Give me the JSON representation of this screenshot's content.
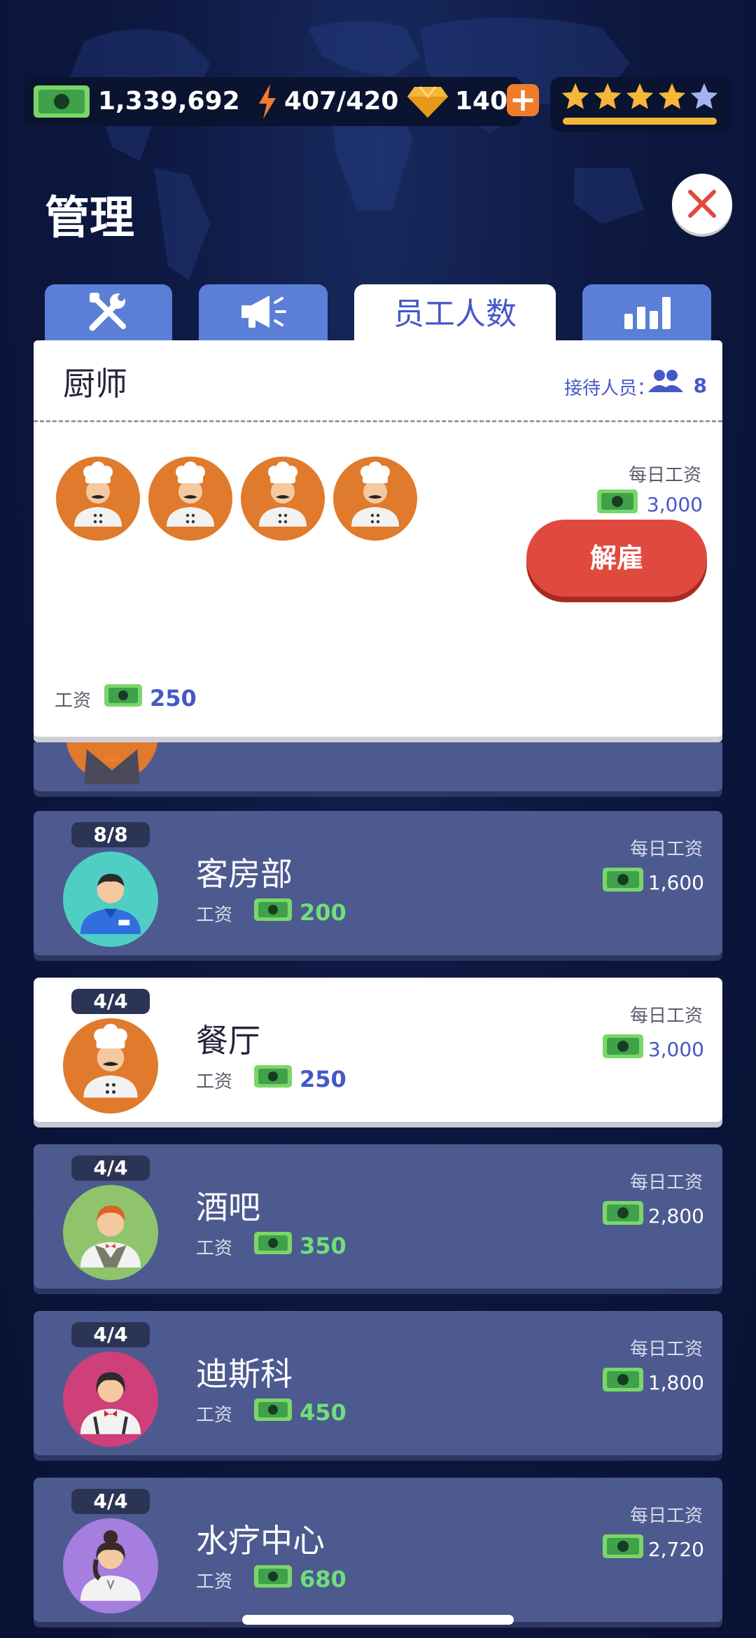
{
  "hud": {
    "money": "1,339,692",
    "energy": "407/420",
    "gems": "140",
    "plus": "+",
    "stars_filled": 4,
    "stars_total": 5
  },
  "page": {
    "title": "管理"
  },
  "tabs": [
    {
      "icon": "tools-icon",
      "label": ""
    },
    {
      "icon": "megaphone-icon",
      "label": ""
    },
    {
      "icon": "",
      "label": "员工人数"
    },
    {
      "icon": "bar-chart-icon",
      "label": ""
    }
  ],
  "detail": {
    "name": "厨师",
    "reception_label": "接待人员：",
    "reception_count": "8",
    "daily_wage_label": "每日工资",
    "daily_wage": "3,000",
    "fire_button": "解雇",
    "wage_label": "工资",
    "wage": "250",
    "staff_count": 4
  },
  "departments": [
    {
      "count": "8/8",
      "name": "客房部",
      "wage_label": "工资",
      "wage": "200",
      "daily_label": "每日工资",
      "daily": "1,600",
      "avatar": "housekeeper",
      "selected": false
    },
    {
      "count": "4/4",
      "name": "餐厅",
      "wage_label": "工资",
      "wage": "250",
      "daily_label": "每日工资",
      "daily": "3,000",
      "avatar": "chef",
      "selected": true
    },
    {
      "count": "4/4",
      "name": "酒吧",
      "wage_label": "工资",
      "wage": "350",
      "daily_label": "每日工资",
      "daily": "2,800",
      "avatar": "bartender",
      "selected": false
    },
    {
      "count": "4/4",
      "name": "迪斯科",
      "wage_label": "工资",
      "wage": "450",
      "daily_label": "每日工资",
      "daily": "1,800",
      "avatar": "waitress",
      "selected": false
    },
    {
      "count": "4/4",
      "name": "水疗中心",
      "wage_label": "工资",
      "wage": "680",
      "daily_label": "每日工资",
      "daily": "2,720",
      "avatar": "spa-staff",
      "selected": false
    }
  ],
  "colors": {
    "accent_blue": "#4558c8",
    "fire_red": "#e04a3e",
    "wage_green": "#6ee07a",
    "card_bg": "#4d5a8f",
    "star_gold": "#f5b73a"
  }
}
